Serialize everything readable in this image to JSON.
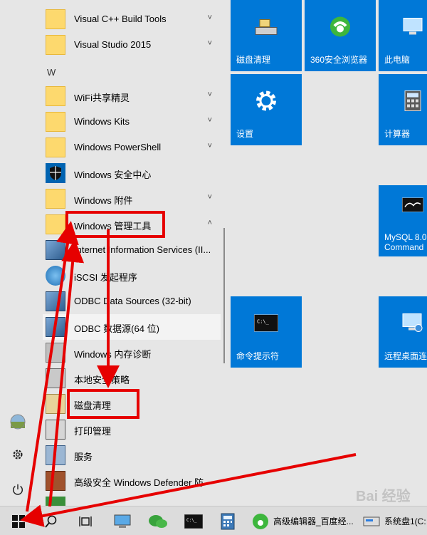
{
  "start_menu": {
    "apps": [
      {
        "label": "Visual C++ Build Tools",
        "icon": "folder-icon",
        "chevron": "˅"
      },
      {
        "label": "Visual Studio 2015",
        "icon": "folder-icon",
        "chevron": "˅"
      },
      {
        "label": "WiFi共享精灵",
        "icon": "folder-icon",
        "chevron": "˅"
      },
      {
        "label": "Windows Kits",
        "icon": "folder-icon",
        "chevron": "˅"
      },
      {
        "label": "Windows PowerShell",
        "icon": "folder-icon",
        "chevron": "˅"
      },
      {
        "label": "Windows 安全中心",
        "icon": "shield-icon",
        "chevron": ""
      },
      {
        "label": "Windows 附件",
        "icon": "folder-icon",
        "chevron": "˅"
      },
      {
        "label": "Windows 管理工具",
        "icon": "folder-icon",
        "chevron": "˄"
      },
      {
        "label": "Internet Information Services (II...",
        "icon": "iis-icon",
        "chevron": ""
      },
      {
        "label": "iSCSI 发起程序",
        "icon": "iscsi-icon",
        "chevron": ""
      },
      {
        "label": "ODBC Data Sources (32-bit)",
        "icon": "odbc-icon",
        "chevron": ""
      },
      {
        "label": "ODBC 数据源(64 位)",
        "icon": "odbc-icon",
        "chevron": ""
      },
      {
        "label": "Windows 内存诊断",
        "icon": "memory-icon",
        "chevron": ""
      },
      {
        "label": "本地安全策略",
        "icon": "policy-icon",
        "chevron": ""
      },
      {
        "label": "磁盘清理",
        "icon": "disk-cleanup-icon",
        "chevron": ""
      },
      {
        "label": "打印管理",
        "icon": "printer-icon",
        "chevron": ""
      },
      {
        "label": "服务",
        "icon": "services-icon",
        "chevron": ""
      },
      {
        "label": "高级安全 Windows Defender 防",
        "icon": "firewall-icon",
        "chevron": ""
      }
    ],
    "section_letter": "W"
  },
  "tiles": [
    {
      "label": "磁盘清理",
      "icon": "disk-cleanup-icon"
    },
    {
      "label": "360安全浏览器",
      "icon": "browser-360-icon"
    },
    {
      "label": "此电脑",
      "icon": "computer-icon"
    },
    {
      "label": "设置",
      "icon": "gear-icon"
    },
    {
      "label": "计算器",
      "icon": "calculator-icon"
    },
    {
      "label": "MySQL 8.0 Command",
      "icon": "mysql-icon"
    },
    {
      "label": "命令提示符",
      "icon": "cmd-icon"
    },
    {
      "label": "远程桌面连接",
      "icon": "remote-desktop-icon"
    }
  ],
  "taskbar": {
    "apps": [
      {
        "label": "高级编辑器_百度经...",
        "icon": "browser-360-icon"
      },
      {
        "label": "系统盘1(C:",
        "icon": "drive-icon"
      }
    ]
  },
  "watermark": "Bai 经验",
  "colors": {
    "tile": "#0078d7",
    "annotation": "#e60000",
    "folder": "#fdd96e"
  }
}
